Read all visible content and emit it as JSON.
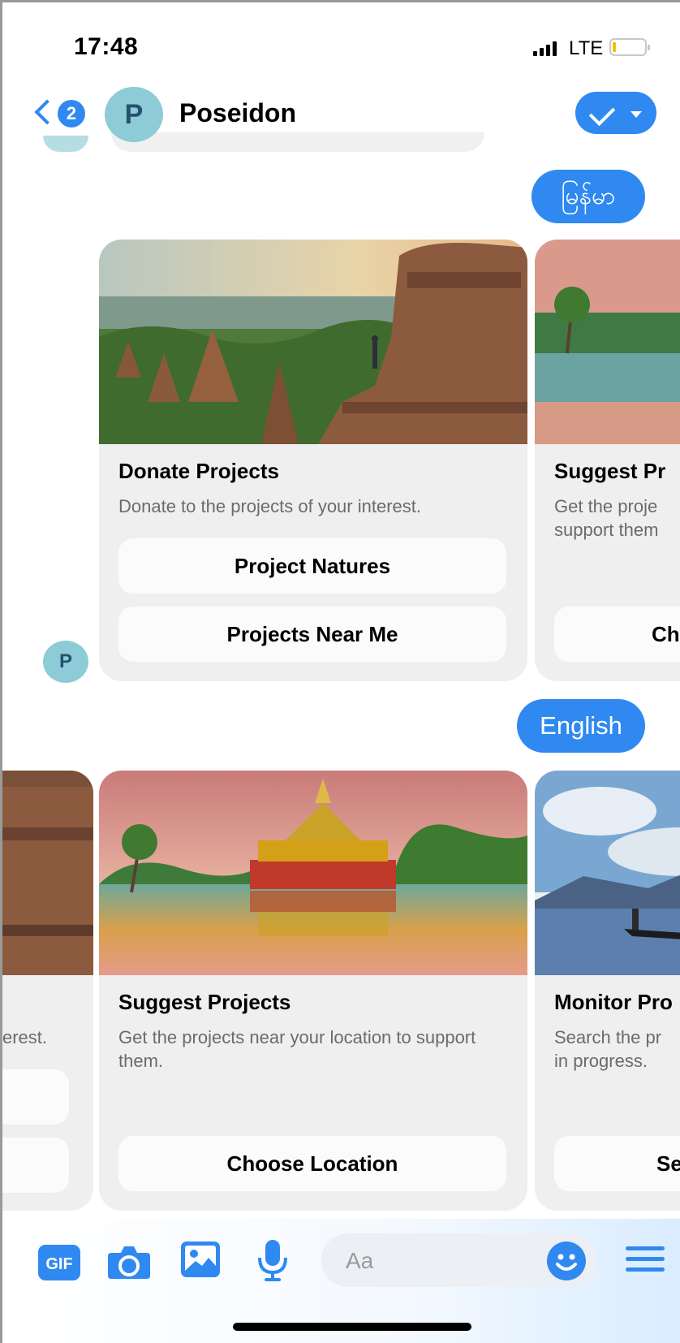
{
  "status_bar": {
    "time": "17:48",
    "network": "LTE"
  },
  "header": {
    "back_count": "2",
    "avatar_letter": "P",
    "contact_name": "Poseidon"
  },
  "messages": {
    "pill_1": "မြန်မာ",
    "pill_2": "English",
    "avatar_letter": "P"
  },
  "carousel_1": {
    "card_main": {
      "title": "Donate Projects",
      "subtitle": "Donate to the projects of your interest.",
      "buttons": [
        "Project Natures",
        "Projects Near Me"
      ]
    },
    "card_peek": {
      "title": "Suggest Pr",
      "subtitle_line1": "Get the proje",
      "subtitle_line2": "support them",
      "button": "Ch"
    }
  },
  "carousel_2": {
    "card_prev": {
      "subtitle_tail": "erest."
    },
    "card_main": {
      "title": "Suggest Projects",
      "subtitle": "Get the projects near your location to support them.",
      "button": "Choose Location"
    },
    "card_peek": {
      "title": "Monitor Pro",
      "subtitle_line1": "Search the pr",
      "subtitle_line2": "in progress.",
      "button": "Se"
    }
  },
  "composer": {
    "gif_label": "GIF",
    "placeholder": "Aa"
  },
  "colors": {
    "accent": "#2f89f0",
    "avatar": "#8dcbd6",
    "card": "#efefef"
  }
}
